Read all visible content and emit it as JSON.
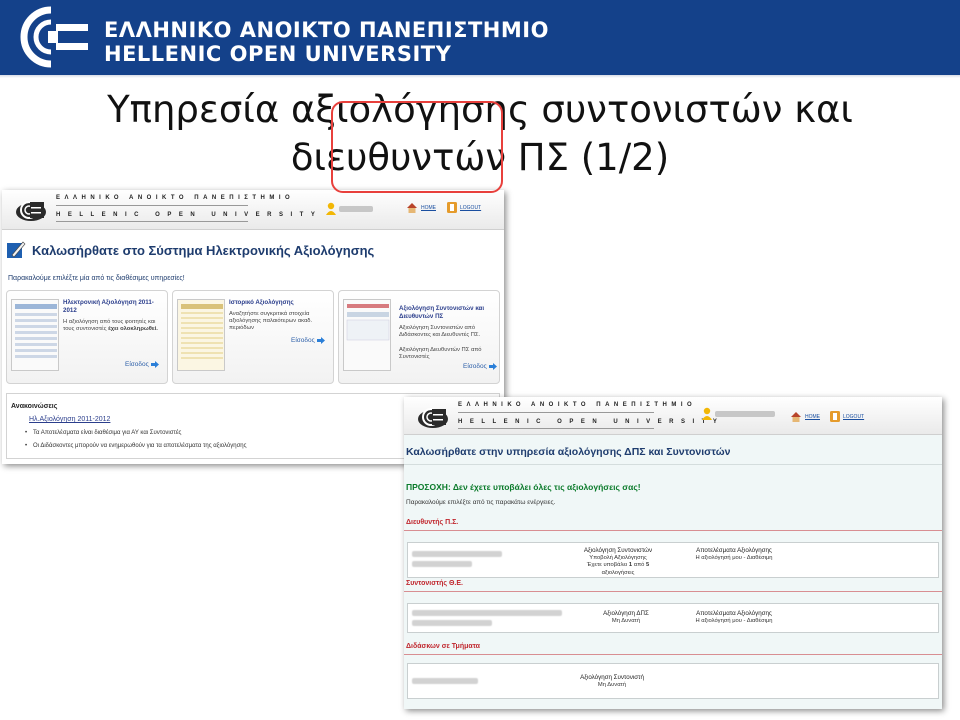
{
  "banner": {
    "greek": "ΕΛΛΗΝΙΚΟ ΑΝΟΙΚΤΟ ΠΑΝΕΠΙΣΤΗΜΙΟ",
    "english": "HELLENIC OPEN UNIVERSITY"
  },
  "slide": {
    "title_line1": "Υπηρεσία αξιολόγησης συντονιστών και",
    "title_line2": "διευθυντών ΠΣ (1/2)"
  },
  "shot_header": {
    "greek": "ΕΛΛΗΝΙΚΟ ΑΝΟΙΚΤΟ ΠΑΝΕΠΙΣΤΗΜΙΟ",
    "english": "HELLENIC OPEN UNIVERSITY",
    "home": "HOME",
    "logout": "LOGOUT"
  },
  "shot1": {
    "welcome": "Καλωσήρθατε στο Σύστημα Ηλεκτρονικής Αξιολόγησης",
    "please": "Παρακαλούμε επιλέξτε μία από τις διαθέσιμες υπηρεσίες!",
    "cards": [
      {
        "title": "Ηλεκτρονική Αξιολόγηση 2011-2012",
        "desc": "Η αξιολόγηση από τους φοιτητές και τους συντονιστές",
        "desc_bold": "έχει ολοκληρωθεί.",
        "link": "Είσοδος"
      },
      {
        "title": "Ιστορικό Αξιολόγησης",
        "desc": "Αναζητήστε συγκριτικά στοιχεία αξιολόγησης παλαιότερων ακαδ. περιόδων",
        "link": "Είσοδος"
      },
      {
        "title": "Αξιολόγηση Συντονιστών και Διευθυντών ΠΣ",
        "desc1": "Αξιολόγηση Συντονιστών από Διδάσκοντες και Διευθυντές ΠΣ.",
        "desc2": "Αξιολόγηση Διευθυντών ΠΣ από Συντονιστές",
        "link": "Είσοδος"
      }
    ],
    "announcements": {
      "heading": "Ανακοινώσεις",
      "link": "Ηλ.Αξιολόγηση 2011-2012",
      "items": [
        "Τα Αποτελέσματα είναι διαθέσιμα για ΑΥ και Συντονιστές",
        "Οι Διδάσκοντες μπορούν να ενημερωθούν για τα αποτελέσματα της αξιολόγησης"
      ]
    }
  },
  "shot2": {
    "welcome": "Καλωσήρθατε στην υπηρεσία αξιολόγησης ΔΠΣ και Συντονιστών",
    "warning": "ΠΡΟΣΟΧΗ: Δεν έχετε υποβάλει όλες τις αξιολογήσεις σας!",
    "please": "Παρακαλούμε επιλέξτε από τις παρακάτω ενέργειες.",
    "sections": [
      {
        "title": "Διευθυντής Π.Σ.",
        "col1_title": "Αξιολόγηση Συντονιστών",
        "col1_l1": "Υποβολή Αξιολόγησης",
        "col1_l2a": "Έχετε υποβάλει",
        "col1_n1": "1",
        "col1_mid": "από",
        "col1_n2": "5",
        "col1_l3": "αξιολογήσεις",
        "col2_title": "Αποτελέσματα Αξιολόγησης",
        "col2_l1": "Η αξιολόγησή μου - Διαθέσιμη"
      },
      {
        "title": "Συντονιστής Θ.Ε.",
        "col1_title": "Αξιολόγηση ΔΠΣ",
        "col1_l1": "Μη Δυνατή",
        "col2_title": "Αποτελέσματα Αξιολόγησης",
        "col2_l1": "Η αξιολόγησή μου - Διαθέσιμη"
      },
      {
        "title": "Διδάσκων σε Τμήματα",
        "col1_title": "Αξιολόγηση Συντονιστή",
        "col1_l1": "Μη Δυνατή"
      }
    ]
  },
  "colors": {
    "banner": "#14418a",
    "highlight_ring": "#e8403c",
    "warning_green": "#0a7a2a",
    "section_red": "#c0262d"
  }
}
